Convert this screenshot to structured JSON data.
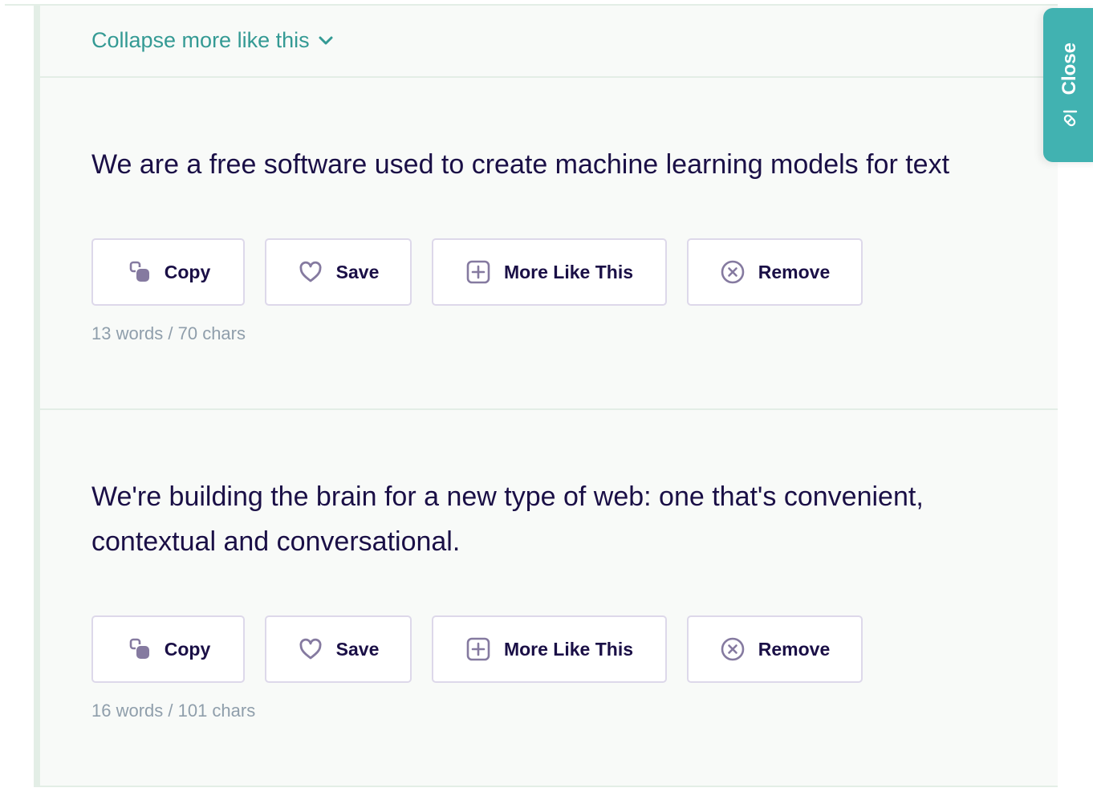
{
  "collapse": {
    "label": "Collapse more like this",
    "icon": "chevron-down-icon"
  },
  "close_tab": {
    "label": "Close",
    "icon": "pencil-icon"
  },
  "button_labels": {
    "copy": "Copy",
    "save": "Save",
    "more_like_this": "More Like This",
    "remove": "Remove"
  },
  "icons": {
    "copy": "copy-icon",
    "save": "heart-icon",
    "more_like_this": "plus-square-icon",
    "remove": "x-circle-icon"
  },
  "results": [
    {
      "text": "We are a free software used to create machine learning models for text",
      "stats": "13 words / 70 chars"
    },
    {
      "text": "We're building the brain for a new type of web: one that's convenient, contextual and conversational.",
      "stats": "16 words / 101 chars"
    }
  ],
  "colors": {
    "accent_teal": "#41b2b1",
    "link_teal": "#349a94",
    "text_dark": "#1a0f46",
    "icon_purple": "#857aa0",
    "muted_gray": "#8f9eab",
    "border_light": "#ddd8ea",
    "panel_bg": "#f8faf8",
    "divider": "#e3eee6"
  }
}
